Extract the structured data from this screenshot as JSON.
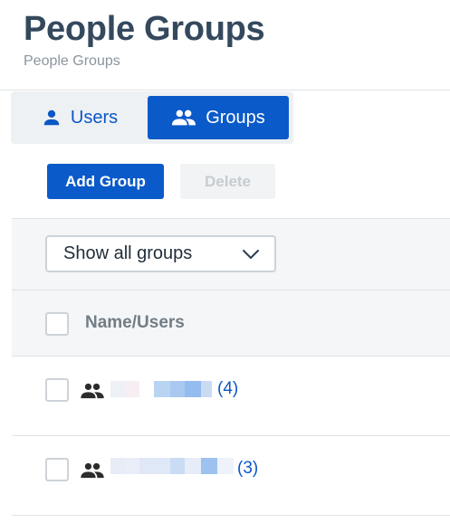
{
  "header": {
    "title": "People Groups",
    "breadcrumb": "People Groups"
  },
  "tabs": [
    {
      "label": "Users",
      "icon": "person-icon",
      "selected": false
    },
    {
      "label": "Groups",
      "icon": "people-icon",
      "selected": true
    }
  ],
  "toolbar": {
    "add_label": "Add Group",
    "delete_label": "Delete"
  },
  "filter": {
    "selected": "Show all groups"
  },
  "table": {
    "column_header": "Name/Users",
    "rows": [
      {
        "name": "",
        "count": "(4)"
      },
      {
        "name": "",
        "count": "(3)"
      }
    ]
  },
  "colors": {
    "accent": "#0a5ac9",
    "link": "#0b57c5",
    "title": "#34495e"
  }
}
